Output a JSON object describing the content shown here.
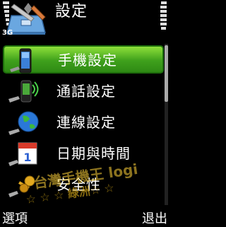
{
  "status": {
    "network": "3G"
  },
  "header": {
    "title": "設定"
  },
  "menu": {
    "items": [
      {
        "label": "手機設定",
        "icon": "phone-icon",
        "selected": true
      },
      {
        "label": "通話設定",
        "icon": "call-icon"
      },
      {
        "label": "連線設定",
        "icon": "globe-icon"
      },
      {
        "label": "日期與時間",
        "icon": "calendar-icon"
      },
      {
        "label": "安全性",
        "icon": "keys-icon"
      }
    ]
  },
  "watermark": {
    "line1": "台灣手機王 logi",
    "line2": "☆ ☆ ☆ 綠洲☆ ☆"
  },
  "softkeys": {
    "left": "選項",
    "right": "退出"
  },
  "colors": {
    "accent": "#4bb522",
    "background": "#000000"
  }
}
